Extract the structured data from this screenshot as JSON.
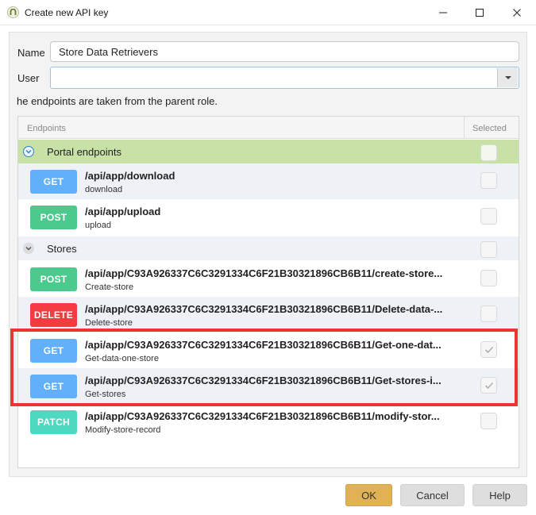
{
  "window": {
    "title": "Create new API key",
    "icon": "app-logo-icon"
  },
  "form": {
    "name_label": "Name",
    "name_value": "Store Data Retrievers",
    "user_label": "User",
    "user_value": "",
    "info_text": "he endpoints are taken from the parent role."
  },
  "grid": {
    "columns": {
      "endpoints": "Endpoints",
      "selected": "Selected"
    },
    "groups": [
      {
        "name": "Portal endpoints",
        "expanded": true,
        "rows": [
          {
            "method": "GET",
            "path": "/api/app/download",
            "description": "download",
            "selected": false
          },
          {
            "method": "POST",
            "path": "/api/app/upload",
            "description": "upload",
            "selected": false
          }
        ]
      },
      {
        "name": "Stores",
        "expanded": true,
        "rows": [
          {
            "method": "POST",
            "path": "/api/app/C93A926337C6C3291334C6F21B30321896CB6B11/create-store...",
            "description": "Create-store",
            "selected": false
          },
          {
            "method": "DELETE",
            "path": "/api/app/C93A926337C6C3291334C6F21B30321896CB6B11/Delete-data-...",
            "description": "Delete-store",
            "selected": false
          },
          {
            "method": "GET",
            "path": "/api/app/C93A926337C6C3291334C6F21B30321896CB6B11/Get-one-dat...",
            "description": "Get-data-one-store",
            "selected": true
          },
          {
            "method": "GET",
            "path": "/api/app/C93A926337C6C3291334C6F21B30321896CB6B11/Get-stores-i...",
            "description": "Get-stores",
            "selected": true
          },
          {
            "method": "PATCH",
            "path": "/api/app/C93A926337C6C3291334C6F21B30321896CB6B11/modify-stor...",
            "description": "Modify-store-record",
            "selected": false
          }
        ]
      }
    ]
  },
  "buttons": {
    "ok": "OK",
    "cancel": "Cancel",
    "help": "Help"
  },
  "colors": {
    "get": "#62affa",
    "post": "#4cc98c",
    "delete": "#f23c3f",
    "patch": "#4dd9bf",
    "group_highlight": "#c7e1a7",
    "ok_button": "#e0b155",
    "annotation_box": "#ee3333"
  }
}
